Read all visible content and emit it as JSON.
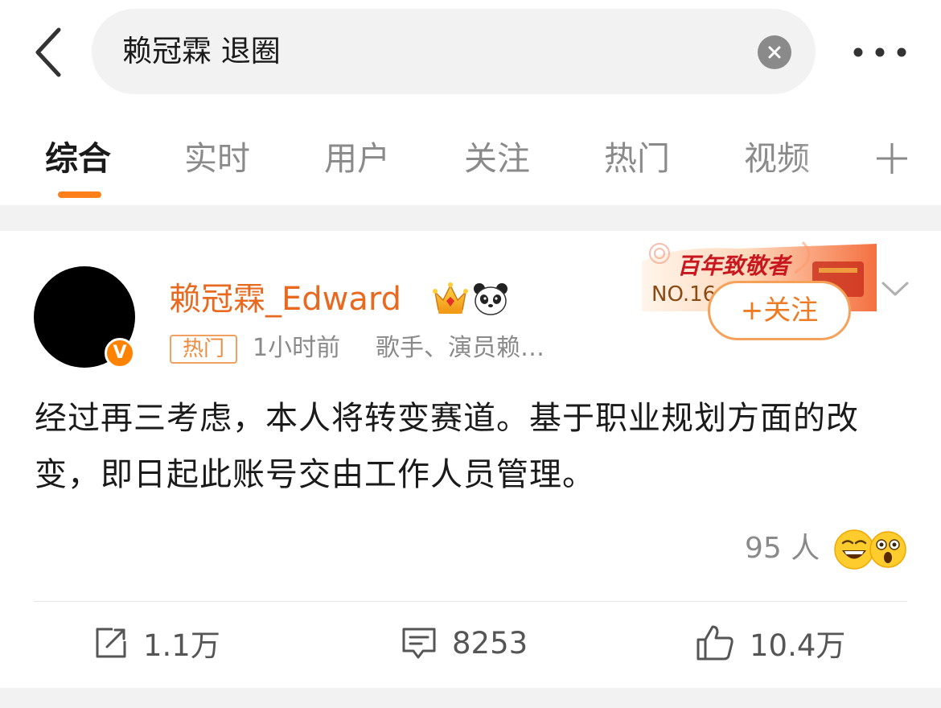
{
  "search": {
    "query": "赖冠霖 退圈"
  },
  "tabs": [
    {
      "label": "综合",
      "active": true
    },
    {
      "label": "实时",
      "active": false
    },
    {
      "label": "用户",
      "active": false
    },
    {
      "label": "关注",
      "active": false
    },
    {
      "label": "热门",
      "active": false
    },
    {
      "label": "视频",
      "active": false
    }
  ],
  "post": {
    "username": "赖冠霖_Edward",
    "hot_tag": "热门",
    "time": "1小时前",
    "description": "歌手、演员赖…",
    "banner_title": "百年致敬者",
    "banner_rank": "NO.16",
    "follow_label": "+关注",
    "content": "经过再三考虑，本人将转变赛道。基于职业规划方面的改变，即日起此账号交由工作人员管理。",
    "reaction_count": "95 人",
    "actions": {
      "repost": "1.1万",
      "comment": "8253",
      "like": "10.4万"
    }
  },
  "colors": {
    "accent": "#ff7f1a",
    "username": "#e86a21",
    "muted_text": "#8a8a8a",
    "page_bg": "#f2f2f2"
  },
  "icons": {
    "back": "chevron-left-icon",
    "clear": "clear-icon",
    "more": "more-horizontal-icon",
    "add_tab": "plus-icon",
    "verified": "verified-badge-icon",
    "crown": "crown-icon",
    "panda": "panda-icon",
    "expand": "chevron-down-icon",
    "repost": "repost-icon",
    "comment": "comment-icon",
    "like": "thumbs-up-icon",
    "reaction_1": "grin-emoji-icon",
    "reaction_2": "surprised-emoji-icon"
  }
}
